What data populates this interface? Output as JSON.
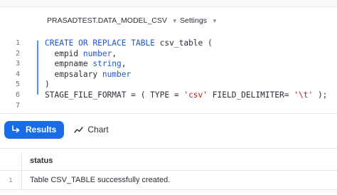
{
  "toolbar": {
    "database_label": "PRASADTEST.DATA_MODEL_CSV",
    "settings_label": "Settings",
    "chevron_icon": "chevron-down-icon"
  },
  "editor": {
    "line_numbers": [
      "1",
      "2",
      "3",
      "4",
      "5",
      "6",
      "7"
    ],
    "lines": [
      "CREATE OR REPLACE TABLE csv_table (",
      "  empid number,",
      "  empname string,",
      "  empsalary number",
      ")",
      "STAGE_FILE_FORMAT = ( TYPE = 'csv' FIELD_DELIMITER= '\\t' );",
      ""
    ],
    "tokens": {
      "l1_kw": "CREATE OR REPLACE TABLE",
      "l1_rest": " csv_table (",
      "l2_name": "  empid ",
      "l2_type": "number",
      "l2_end": ",",
      "l3_name": "  empname ",
      "l3_type": "string",
      "l3_end": ",",
      "l4_name": "  empsalary ",
      "l4_type": "number",
      "l5": ")",
      "l6_a": "STAGE_FILE_FORMAT = ( TYPE = ",
      "l6_str1": "'csv'",
      "l6_b": " FIELD_DELIMITER= ",
      "l6_str2": "'\\t'",
      "l6_c": " );"
    }
  },
  "tabs": {
    "results_label": "Results",
    "chart_label": "Chart",
    "results_icon": "return-arrow-icon",
    "chart_icon": "trend-line-icon"
  },
  "results": {
    "columns": [
      "status"
    ],
    "rows": [
      {
        "row_number": "1",
        "status": "Table CSV_TABLE successfully created."
      }
    ]
  },
  "colors": {
    "accent": "#1a6ce6",
    "keyword": "#1f56c8",
    "string": "#b42318"
  }
}
